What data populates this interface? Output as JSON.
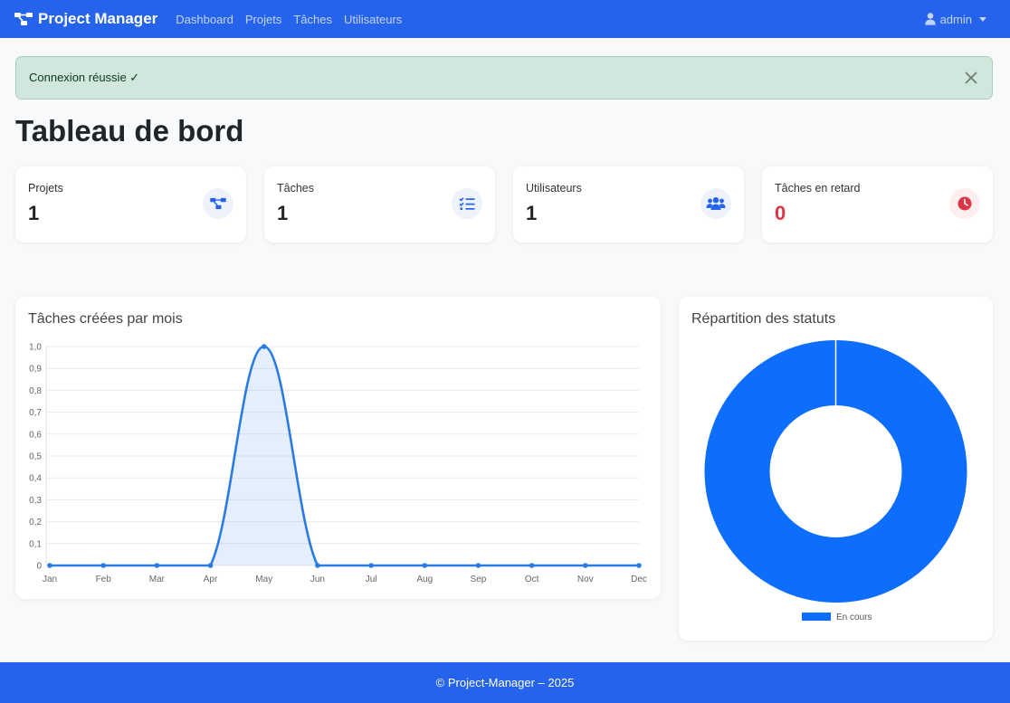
{
  "navbar": {
    "brand": "Project Manager",
    "links": [
      "Dashboard",
      "Projets",
      "Tâches",
      "Utilisateurs"
    ],
    "user": "admin",
    "color": "#2563eb"
  },
  "alert": {
    "message": "Connexion réussie ✓"
  },
  "page": {
    "title": "Tableau de bord"
  },
  "stats": [
    {
      "label": "Projets",
      "value": "1",
      "icon": "diagram-icon"
    },
    {
      "label": "Tâches",
      "value": "1",
      "icon": "checklist-icon"
    },
    {
      "label": "Utilisateurs",
      "value": "1",
      "icon": "users-icon"
    },
    {
      "label": "Tâches en retard",
      "value": "0",
      "icon": "clock-icon"
    }
  ],
  "charts": {
    "line_title": "Tâches créées par mois",
    "pie_title": "Répartition des statuts"
  },
  "chart_data": [
    {
      "type": "line",
      "title": "Tâches créées par mois",
      "categories": [
        "Jan",
        "Feb",
        "Mar",
        "Apr",
        "May",
        "Jun",
        "Jul",
        "Aug",
        "Sep",
        "Oct",
        "Nov",
        "Dec"
      ],
      "values": [
        0,
        0,
        0,
        0,
        1,
        0,
        0,
        0,
        0,
        0,
        0,
        0
      ],
      "ylim": [
        0,
        1
      ],
      "yticks": [
        "0",
        "0,1",
        "0,2",
        "0,3",
        "0,4",
        "0,5",
        "0,6",
        "0,7",
        "0,8",
        "0,9",
        "1,0"
      ],
      "color": "#2b7be4",
      "fill": true,
      "grid": true
    },
    {
      "type": "pie",
      "title": "Répartition des statuts",
      "categories": [
        "En cours"
      ],
      "values": [
        1
      ],
      "colors": [
        "#0d6efd"
      ],
      "donut": true,
      "legend": "bottom"
    }
  ],
  "footer": {
    "text": "© Project-Manager – 2025"
  }
}
